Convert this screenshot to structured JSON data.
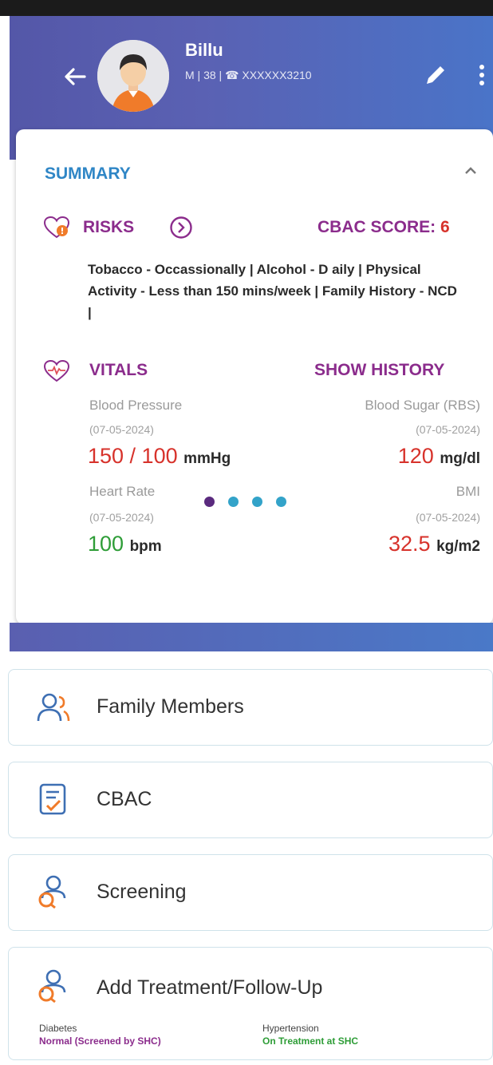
{
  "header": {
    "name": "Billu",
    "meta": "M | 38 | ☎ XXXXXX3210"
  },
  "summary": {
    "title": "SUMMARY",
    "risks_label": "RISKS",
    "cbac_score_label": "CBAC SCORE: ",
    "cbac_score_value": "6",
    "risks_text": "Tobacco - Occassionally | Alcohol - D aily | Physical Activity - Less than 150 mins/week | Family History - NCD |",
    "vitals_label": "VITALS",
    "show_history": "SHOW HISTORY",
    "vitals": {
      "bp": {
        "label": "Blood Pressure",
        "date": "(07-05-2024)",
        "value": "150 / 100",
        "unit": "mmHg"
      },
      "sugar": {
        "label": "Blood Sugar (RBS)",
        "date": "(07-05-2024)",
        "value": "120",
        "unit": "mg/dl"
      },
      "hr": {
        "label": "Heart Rate",
        "date": "(07-05-2024)",
        "value": "100",
        "unit": "bpm"
      },
      "bmi": {
        "label": "BMI",
        "date": "(07-05-2024)",
        "value": "32.5",
        "unit": "kg/m2"
      }
    },
    "pager": {
      "total": 4,
      "active": 1
    }
  },
  "menu": {
    "family": "Family Members",
    "cbac": "CBAC",
    "screening": "Screening",
    "treatment": "Add Treatment/Follow-Up",
    "diabetes_label": "Diabetes",
    "diabetes_status": "Normal (Screened by SHC)",
    "hypertension_label": "Hypertension",
    "hypertension_status": "On Treatment at SHC"
  },
  "colors": {
    "header_start": "#5457a8",
    "header_end": "#4a74c8",
    "purple": "#8b2c8c",
    "blue": "#2f86c6",
    "red": "#d7322b",
    "green": "#2e9d37",
    "dot_active": "#5a2a7e",
    "dot_inactive": "#33a3c9"
  },
  "icons": [
    "back-arrow-icon",
    "avatar-icon",
    "edit-pencil-icon",
    "more-vertical-icon",
    "chevron-up-icon",
    "risk-heart-icon",
    "chevron-right-circle-icon",
    "vitals-heart-icon",
    "family-icon",
    "clipboard-check-icon",
    "screening-icon",
    "treatment-icon"
  ]
}
